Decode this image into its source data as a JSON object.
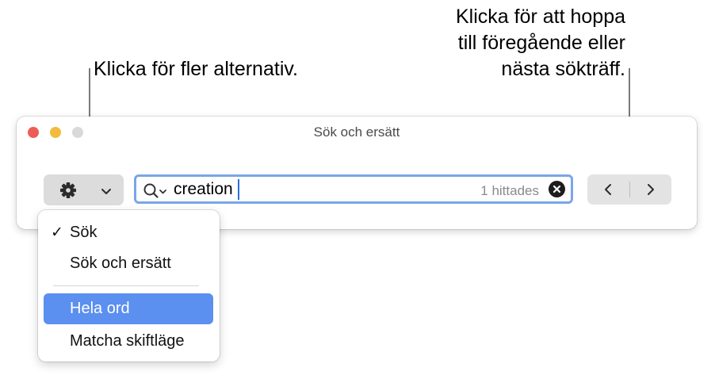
{
  "callouts": {
    "options": "Klicka för fler alternativ.",
    "navigation_lines": [
      "Klicka för att hoppa",
      "till föregående eller",
      "nästa sökträff."
    ]
  },
  "window": {
    "title": "Sök och ersätt"
  },
  "toolbar": {
    "options_button_icon": "gear-icon",
    "options_dropdown_icon": "chevron-down-icon"
  },
  "search": {
    "icon": "magnifier-dropdown-icon",
    "value": "creation",
    "result_count": "1 hittades",
    "clear_icon": "clear-icon"
  },
  "navigation": {
    "prev_icon": "chevron-left-icon",
    "next_icon": "chevron-right-icon"
  },
  "menu": {
    "items": [
      {
        "label": "Sök",
        "checked": true
      },
      {
        "label": "Sök och ersätt",
        "checked": false
      },
      {
        "label": "Hela ord",
        "checked": false,
        "highlighted": true
      },
      {
        "label": "Matcha skiftläge",
        "checked": false
      }
    ],
    "check_mark": "✓"
  },
  "colors": {
    "accent": "#5b8ff0",
    "focus_ring": "#7aa6e6",
    "traffic_close": "#ee5d55",
    "traffic_minimize": "#f2bb3d",
    "traffic_zoom": "#d9d9d9"
  }
}
